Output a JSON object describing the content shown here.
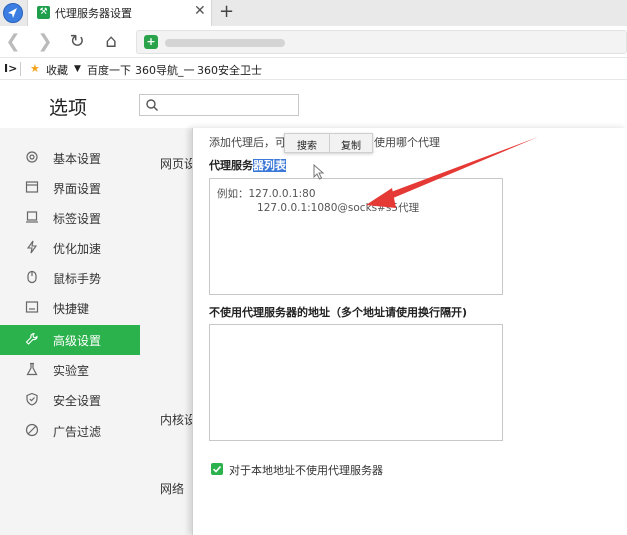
{
  "browser": {
    "tab_title": "代理服务器设置",
    "tab_close": "✕",
    "new_tab": "+",
    "bookmarks": {
      "favorites": "收藏",
      "items": [
        "百度一下",
        "360导航_一",
        "360安全卫士"
      ]
    }
  },
  "settings": {
    "title": "选项",
    "search": {
      "value": "",
      "placeholder": ""
    },
    "sidebar": [
      {
        "label": "基本设置",
        "icon": "settings-icon"
      },
      {
        "label": "界面设置",
        "icon": "window-icon"
      },
      {
        "label": "标签设置",
        "icon": "tab-icon"
      },
      {
        "label": "优化加速",
        "icon": "lightning-icon"
      },
      {
        "label": "鼠标手势",
        "icon": "mouse-icon"
      },
      {
        "label": "快捷键",
        "icon": "keyboard-icon"
      },
      {
        "label": "高级设置",
        "icon": "wrench-icon",
        "active": true
      },
      {
        "label": "实验室",
        "icon": "flask-icon"
      },
      {
        "label": "安全设置",
        "icon": "shield-icon"
      },
      {
        "label": "广告过滤",
        "icon": "block-icon"
      }
    ],
    "sections": [
      "网页设",
      "内核设",
      "网络"
    ]
  },
  "proxy_dialog": {
    "hint_start": "添加代理后，可",
    "hint_end": "使用哪个代理",
    "context_menu": {
      "search": "搜索",
      "copy": "复制"
    },
    "list_label_plain": "代理服务",
    "list_label_selected": "器列表",
    "example_text": "例如：127.0.0.1:80\n            127.0.0.1:1080@socks#s5代理",
    "bypass_label": "不使用代理服务器的地址（多个地址请使用换行隔开)",
    "local_bypass_label": "对于本地地址不使用代理服务器",
    "local_bypass_checked": true
  },
  "colors": {
    "accent": "#2bb24c",
    "selection": "#3b78d8",
    "arrow": "#e53935"
  }
}
